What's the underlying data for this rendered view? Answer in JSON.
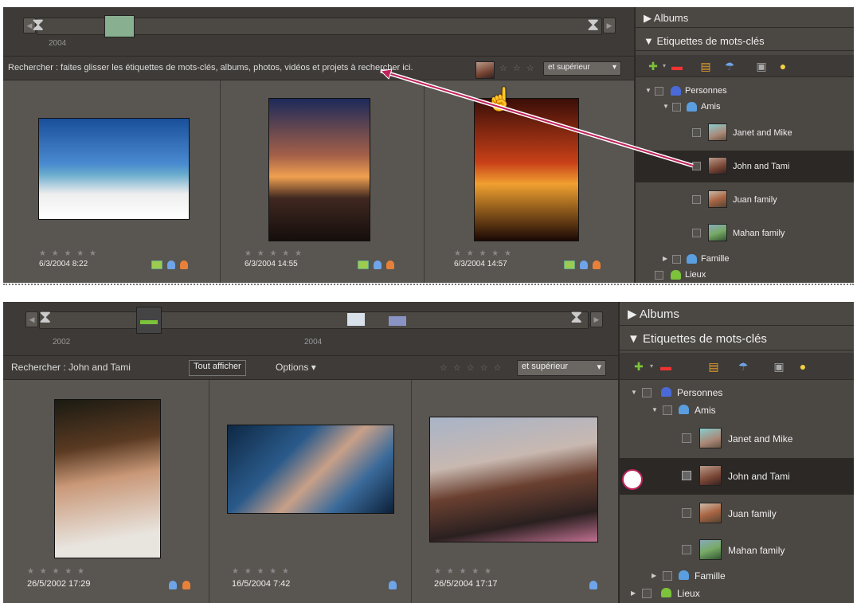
{
  "panel1": {
    "timeline": {
      "years": [
        "2004"
      ]
    },
    "search": {
      "text": "Rechercher : faites glisser les étiquettes de mots-clés, albums, photos, vidéos et projets à rechercher ici.",
      "stars": "☆ ☆ ☆",
      "rating_filter": "et supérieur"
    },
    "photos": [
      {
        "stars": "★ ★ ★ ★ ★",
        "date": "6/3/2004 8:22"
      },
      {
        "stars": "★ ★ ★ ★ ★",
        "date": "6/3/2004 14:55"
      },
      {
        "stars": "★ ★ ★ ★ ★",
        "date": "6/3/2004 14:57"
      }
    ],
    "sidebar": {
      "albums": "Albums",
      "keywords": "Etiquettes de mots-clés",
      "tree": {
        "personnes": "Personnes",
        "amis": "Amis",
        "items": [
          "Janet and Mike",
          "John and Tami",
          "Juan family",
          "Mahan family"
        ],
        "famille": "Famille",
        "lieux": "Lieux"
      }
    }
  },
  "panel2": {
    "timeline": {
      "years": [
        "2002",
        "2004"
      ]
    },
    "search": {
      "label": "Rechercher : John and Tami",
      "show_all": "Tout afficher",
      "options": "Options ▾",
      "stars": "☆ ☆ ☆ ☆ ☆",
      "rating_filter": "et supérieur"
    },
    "photos": [
      {
        "stars": "★ ★ ★ ★ ★",
        "date": "26/5/2002 17:29"
      },
      {
        "stars": "★ ★ ★ ★ ★",
        "date": "16/5/2004 7:42"
      },
      {
        "stars": "★ ★ ★ ★ ★",
        "date": "26/5/2004 17:17"
      }
    ],
    "sidebar": {
      "albums": "Albums",
      "keywords": "Etiquettes de mots-clés",
      "tree": {
        "personnes": "Personnes",
        "amis": "Amis",
        "items": [
          "Janet and Mike",
          "John and Tami",
          "Juan family",
          "Mahan family"
        ],
        "famille": "Famille",
        "lieux": "Lieux"
      }
    }
  },
  "colors": {
    "annotation": "#c0245c",
    "selected_row": "#2b2825",
    "accent_green": "#9ccb50",
    "accent_blue": "#6ea4e8",
    "accent_orange": "#e7813a"
  }
}
